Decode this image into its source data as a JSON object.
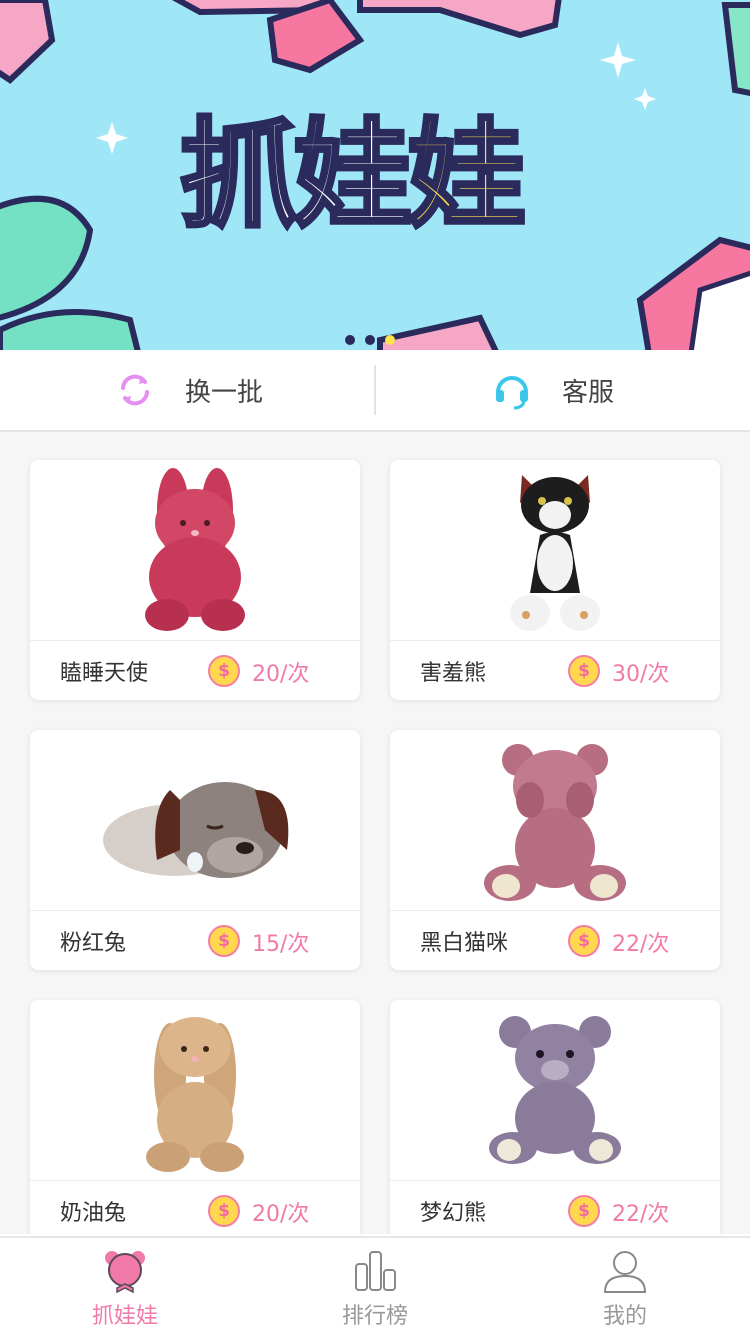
{
  "banner": {
    "title_part1": "抓娃",
    "title_part2": "娃",
    "slides": 3,
    "active_slide": 3
  },
  "actions": {
    "refresh_label": "换一批",
    "service_label": "客服"
  },
  "products": [
    {
      "name": "瞌睡天使",
      "price": "20/次",
      "coin_symbol": "$",
      "image": "red-rabbit"
    },
    {
      "name": "害羞熊",
      "price": "30/次",
      "coin_symbol": "$",
      "image": "black-white-cat"
    },
    {
      "name": "粉红兔",
      "price": "15/次",
      "coin_symbol": "$",
      "image": "sleepy-dog"
    },
    {
      "name": "黑白猫咪",
      "price": "22/次",
      "coin_symbol": "$",
      "image": "pink-bear"
    },
    {
      "name": "奶油兔",
      "price": "20/次",
      "coin_symbol": "$",
      "image": "cream-rabbit"
    },
    {
      "name": "梦幻熊",
      "price": "22/次",
      "coin_symbol": "$",
      "image": "purple-bear"
    }
  ],
  "tabs": [
    {
      "label": "抓娃娃",
      "icon": "bear-icon",
      "active": true
    },
    {
      "label": "排行榜",
      "icon": "ranking-icon",
      "active": false
    },
    {
      "label": "我的",
      "icon": "user-icon",
      "active": false
    }
  ],
  "colors": {
    "banner_bg": "#9fe6f7",
    "accent_pink": "#f27aa9",
    "accent_yellow": "#ffe34d",
    "service_blue": "#39c6ea"
  }
}
